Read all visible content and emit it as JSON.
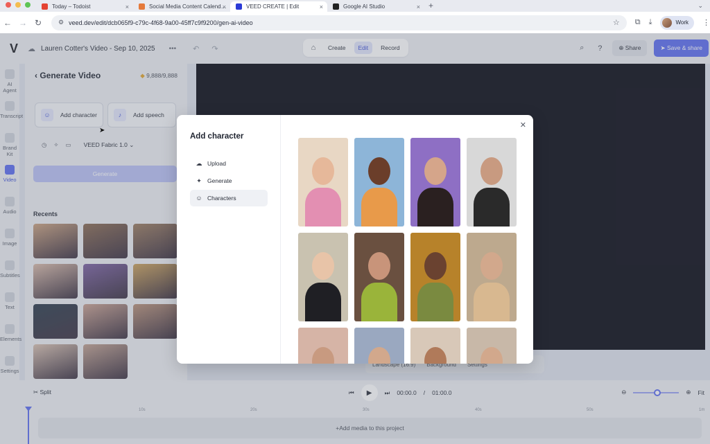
{
  "browser": {
    "tabs": [
      {
        "label": "Today – Todoist",
        "favicon_color": "#e44332",
        "active": false
      },
      {
        "label": "Social Media Content Calend…",
        "favicon_color": "#e57a3b",
        "active": false
      },
      {
        "label": "VEED CREATE | Edit",
        "favicon_color": "#2b3bd6",
        "active": true
      },
      {
        "label": "Google AI Studio",
        "favicon_color": "#222222",
        "active": false
      }
    ],
    "url": "veed.dev/edit/dcb065f9-c79c-4f68-9a00-45ff7c9f9200/gen-ai-video",
    "profile_label": "Work"
  },
  "header": {
    "logo": "V",
    "project_title": "Lauren Cotter's Video - Sep 10, 2025",
    "modes": [
      "Create",
      "Edit",
      "Record"
    ],
    "active_mode": "Edit",
    "share_label": "Share",
    "save_label": "Save & share"
  },
  "rail": [
    {
      "label": "AI Agent",
      "active": false
    },
    {
      "label": "Transcript",
      "active": false
    },
    {
      "label": "Brand Kit",
      "active": false
    },
    {
      "label": "Video",
      "active": true
    },
    {
      "label": "Audio",
      "active": false
    },
    {
      "label": "Image",
      "active": false
    },
    {
      "label": "Subtitles",
      "active": false
    },
    {
      "label": "Text",
      "active": false
    },
    {
      "label": "Elements",
      "active": false
    },
    {
      "label": "Settings",
      "active": false
    }
  ],
  "panel": {
    "title": "Generate Video",
    "credits": "9,888/9,888",
    "add_character_label": "Add character",
    "add_speech_label": "Add speech",
    "model_label": "VEED Fabric 1.0",
    "generate_label": "Generate",
    "recents_label": "Recents",
    "recent_thumbs": [
      "#c9a07e",
      "#8a6a52",
      "#9a7a5e",
      "#d8b9a8",
      "#7a5fa0",
      "#caa05a",
      "#2a3a4a",
      "#c8a090",
      "#b89078",
      "#d8c0b0",
      "#c0a090"
    ]
  },
  "canvas": {
    "aspect_label": "Landscape (16:9)",
    "background_label": "Background",
    "settings_label": "Settings"
  },
  "timeline": {
    "split_label": "Split",
    "current_time": "00:00.0",
    "total_time": "01:00.0",
    "fit_label": "Fit",
    "ticks": [
      "10s",
      "20s",
      "30s",
      "40s",
      "50s",
      "1m"
    ],
    "add_media_label": "Add media to this project"
  },
  "modal": {
    "title": "Add character",
    "menu": [
      {
        "label": "Upload",
        "icon": "cloud-upload-icon",
        "active": false
      },
      {
        "label": "Generate",
        "icon": "sparkles-icon",
        "active": false
      },
      {
        "label": "Characters",
        "icon": "person-icon",
        "active": true
      }
    ],
    "characters": [
      {
        "bg": "#e8d7c4",
        "skin": "#e6b89a",
        "cloth": "#e38fb2"
      },
      {
        "bg": "#8db5d8",
        "skin": "#6b3e2a",
        "cloth": "#e89a4a"
      },
      {
        "bg": "#8e6fc4",
        "skin": "#d5a58a",
        "cloth": "#2a2020"
      },
      {
        "bg": "#d8d8d8",
        "skin": "#c89a80",
        "cloth": "#2a2a2a"
      },
      {
        "bg": "#c9c2b0",
        "skin": "#e8c4a8",
        "cloth": "#1f1f24"
      },
      {
        "bg": "#6a5040",
        "skin": "#c8947a",
        "cloth": "#9ab43a"
      },
      {
        "bg": "#b7822a",
        "skin": "#6a4230",
        "cloth": "#7a8a40"
      },
      {
        "bg": "#bda98e",
        "skin": "#d2a88c",
        "cloth": "#d8b890"
      },
      {
        "bg": "#d6b4a6",
        "skin": "#c89a80",
        "cloth": "#d6b4a6"
      },
      {
        "bg": "#9aa8c0",
        "skin": "#d2a88c",
        "cloth": "#e8e8e8"
      },
      {
        "bg": "#d8c8b8",
        "skin": "#b07a5a",
        "cloth": "#d8c8b8"
      },
      {
        "bg": "#c8b8a8",
        "skin": "#d2a88c",
        "cloth": "#c8b8a8"
      }
    ]
  },
  "colors": {
    "accent": "#5b6cf0",
    "accent_light": "#b9c0f5"
  }
}
